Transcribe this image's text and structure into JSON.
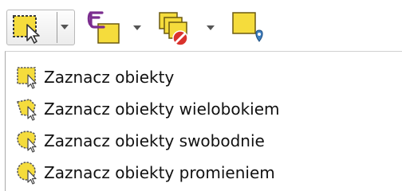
{
  "toolbar": {
    "buttons": [
      {
        "icon": "select-features-icon",
        "has_dropdown": true
      },
      {
        "icon": "select-by-expression-icon",
        "has_dropdown": true
      },
      {
        "icon": "deselect-features-icon",
        "has_dropdown": true
      },
      {
        "icon": "select-by-location-icon",
        "has_dropdown": false
      }
    ]
  },
  "menu": {
    "items": [
      {
        "label": "Zaznacz obiekty",
        "icon": "select-rectangle-icon"
      },
      {
        "label": "Zaznacz obiekty wielobokiem",
        "icon": "select-polygon-icon"
      },
      {
        "label": "Zaznacz obiekty swobodnie",
        "icon": "select-freehand-icon"
      },
      {
        "label": "Zaznacz obiekty promieniem",
        "icon": "select-radius-icon"
      }
    ]
  },
  "colors": {
    "feature_yellow": "#f5dc3c",
    "feature_outline": "#6b5a10",
    "expression_purple": "#7b2d8f",
    "deselect_red": "#d9322c",
    "location_pin_blue": "#3f7fbf"
  }
}
